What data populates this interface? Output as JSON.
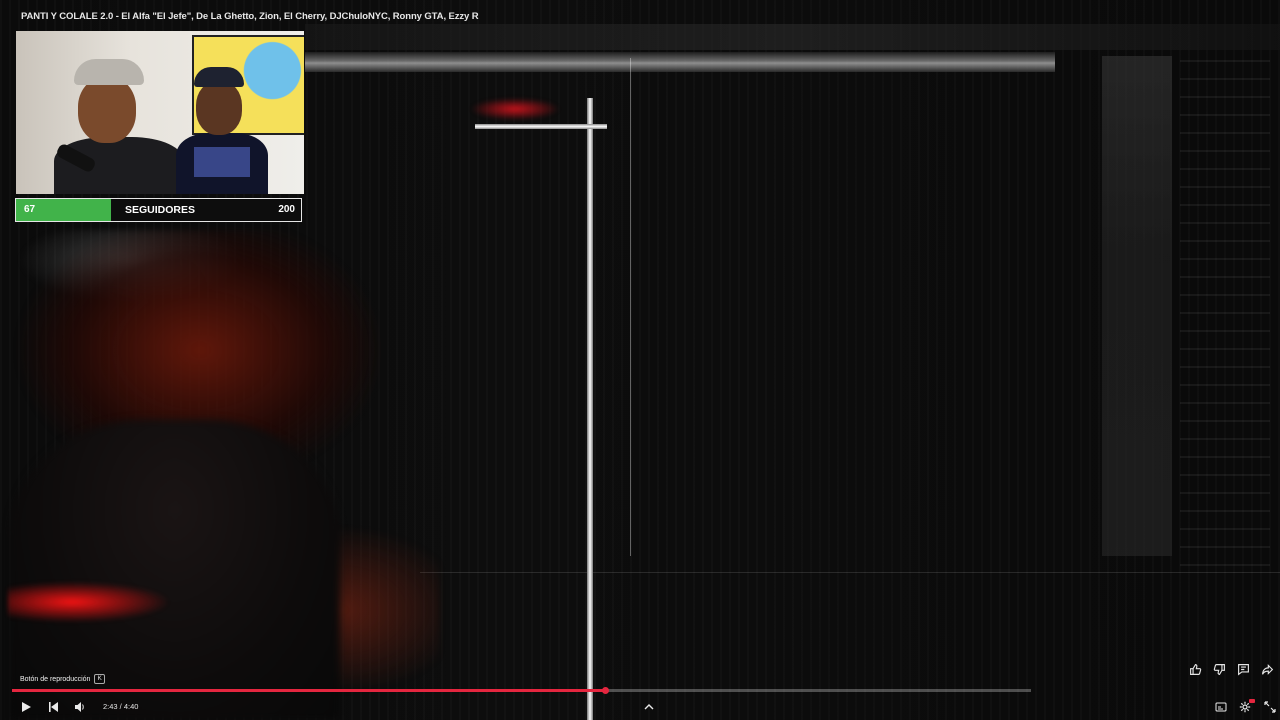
{
  "video": {
    "title": "PANTI Y COLALE 2.0 - El Alfa \"El Jefe\", De La Ghetto, Zion, El Cherry, DJChuloNYC, Ronny GTA, Ezzy R"
  },
  "follower_goal": {
    "current": "67",
    "label": "SEGUIDORES",
    "goal": "200",
    "fill_fraction": 0.335,
    "fill_color": "#41b34a"
  },
  "tooltip": {
    "text": "Botón de reproducción",
    "shortcut": "K"
  },
  "playback": {
    "time_display": "2:43 / 4:40",
    "progress_fraction": 0.582,
    "played_color": "#e5263f"
  },
  "controls": {
    "left": [
      "play-icon",
      "previous-icon",
      "volume-icon"
    ],
    "center": [
      "chevron-up-icon"
    ],
    "right": [
      "subtitles-icon",
      "settings-icon",
      "fullscreen-icon"
    ]
  },
  "side_actions": [
    "thumbs-up-icon",
    "thumbs-down-icon",
    "comment-icon",
    "share-icon"
  ]
}
